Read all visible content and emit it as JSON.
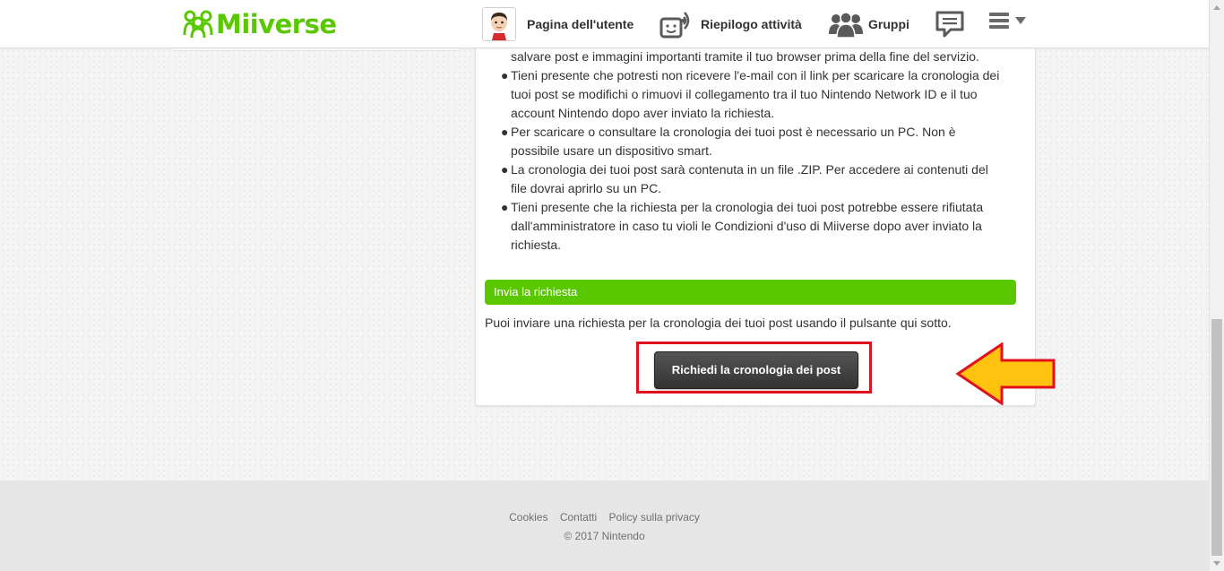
{
  "header": {
    "logo_text": "Miiverse",
    "nav": {
      "user_page": "Pagina dell'utente",
      "activity": "Riepilogo attività",
      "groups": "Gruppi"
    },
    "icons": [
      "miiverse-logo-icon",
      "mii-avatar-icon",
      "activity-feed-icon",
      "groups-icon",
      "messages-icon",
      "menu-icon"
    ]
  },
  "content": {
    "bullets": [
      "salvare post e immagini importanti tramite il tuo browser prima della fine del servizio.",
      "Tieni presente che potresti non ricevere l'e-mail con il link per scaricare la cronologia dei tuoi post se modifichi o rimuovi il collegamento tra il tuo Nintendo Network ID e il tuo account Nintendo dopo aver inviato la richiesta.",
      "Per scaricare o consultare la cronologia dei tuoi post è necessario un PC. Non è possibile usare un dispositivo smart.",
      "La cronologia dei tuoi post sarà contenuta in un file .ZIP. Per accedere ai contenuti del file dovrai aprirlo su un PC.",
      "Tieni presente che la richiesta per la cronologia dei tuoi post potrebbe essere rifiutata dall'amministratore in caso tu violi le Condizioni d'uso di Miiverse dopo aver inviato la richiesta."
    ],
    "section_title": "Invia la richiesta",
    "section_desc": "Puoi inviare una richiesta per la cronologia dei tuoi post usando il pulsante qui sotto.",
    "request_button": "Richiedi la cronologia dei post"
  },
  "footer": {
    "links": [
      "Cookies",
      "Contatti",
      "Policy sulla privacy"
    ],
    "copyright": "© 2017 Nintendo"
  },
  "colors": {
    "brand_green": "#5ac800",
    "highlight_red": "#e0101e",
    "arrow_yellow": "#ffc20e"
  }
}
